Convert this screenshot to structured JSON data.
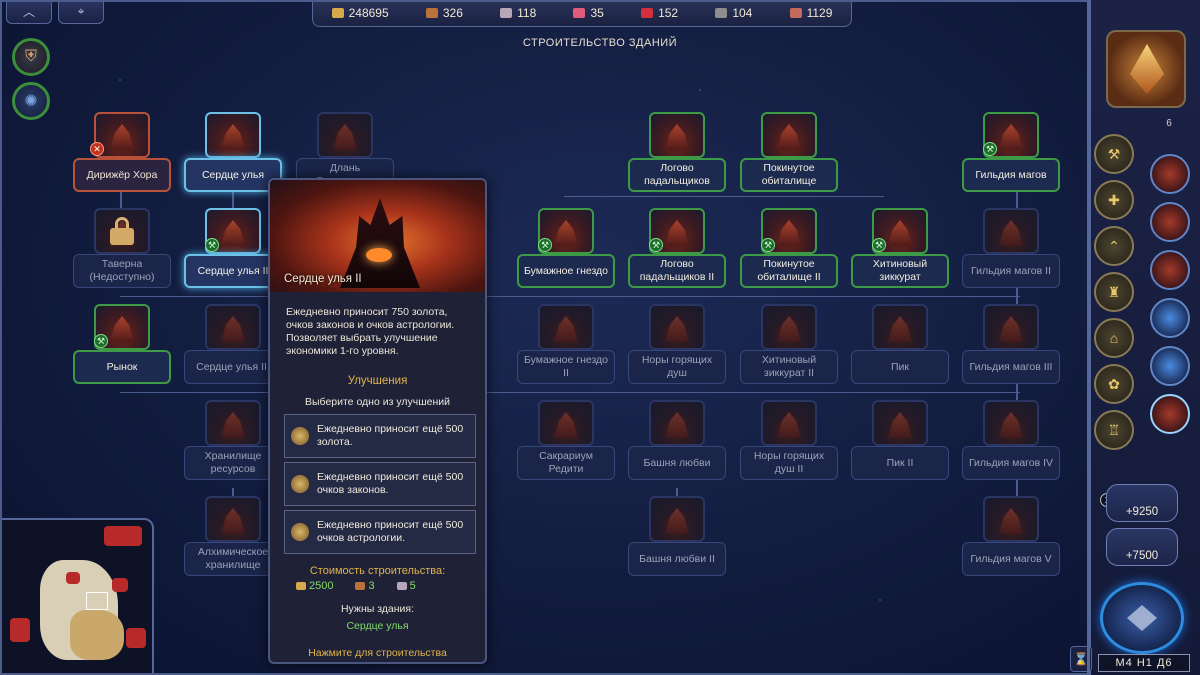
{
  "window_title": "СТРОИТЕЛЬСТВО ЗДАНИЙ",
  "resources": [
    {
      "name": "gold",
      "value": "248695",
      "color": "#d8a94a"
    },
    {
      "name": "wood",
      "value": "326",
      "color": "#b9733a"
    },
    {
      "name": "ore",
      "value": "118",
      "color": "#b7a6b8"
    },
    {
      "name": "crystals",
      "value": "35",
      "color": "#e25a7a"
    },
    {
      "name": "gems",
      "value": "152",
      "color": "#d2303a"
    },
    {
      "name": "mercury",
      "value": "104",
      "color": "#8e8e8e"
    },
    {
      "name": "sulfur",
      "value": "1129",
      "color": "#c46a5a"
    }
  ],
  "buildings": [
    {
      "label": "Дирижёр Хора",
      "state": "red"
    },
    {
      "label": "Сердце улья",
      "state": "built"
    },
    {
      "label": "Длань Вельзевула",
      "state": "dim"
    },
    {
      "label": "Логово падальщиков",
      "state": "built"
    },
    {
      "label": "Покинутое обиталище",
      "state": "built"
    },
    {
      "label": "Гильдия магов",
      "state": "built"
    },
    {
      "label": "Таверна (Недоступно)",
      "state": "locked"
    },
    {
      "label": "Сердце улья II",
      "state": "sel"
    },
    {
      "label": "Бумажное гнездо",
      "state": "built"
    },
    {
      "label": "Логово падальщиков II",
      "state": "built"
    },
    {
      "label": "Покинутое обиталище II",
      "state": "built"
    },
    {
      "label": "Хитиновый зиккурат",
      "state": "built"
    },
    {
      "label": "Гильдия магов II",
      "state": "dim"
    },
    {
      "label": "Рынок",
      "state": "built"
    },
    {
      "label": "Сердце улья III",
      "state": "dim"
    },
    {
      "label": "Бумажное гнездо II",
      "state": "dim"
    },
    {
      "label": "Норы горящих душ",
      "state": "dim"
    },
    {
      "label": "Хитиновый зиккурат II",
      "state": "dim"
    },
    {
      "label": "Пик",
      "state": "dim"
    },
    {
      "label": "Гильдия магов III",
      "state": "dim"
    },
    {
      "label": "Хранилище ресурсов",
      "state": "dim"
    },
    {
      "label": "Сакрариум Редити",
      "state": "dim"
    },
    {
      "label": "Башня любви",
      "state": "dim"
    },
    {
      "label": "Норы горящих душ II",
      "state": "dim"
    },
    {
      "label": "Пик II",
      "state": "dim"
    },
    {
      "label": "Гильдия магов IV",
      "state": "dim"
    },
    {
      "label": "Алхимическое хранилище",
      "state": "dim"
    },
    {
      "label": "Башня любви II",
      "state": "dim"
    },
    {
      "label": "Гильдия магов V",
      "state": "dim"
    }
  ],
  "tooltip": {
    "title": "Сердце улья II",
    "description": "Ежедневно приносит 750 золота, очков законов и очков астрологии. Позволяет выбрать улучшение экономики 1-го уровня.",
    "upgrades_title": "Улучшения",
    "upgrades_subtitle": "Выберите одно из улучшений",
    "options": [
      {
        "text": "Ежедневно приносит ещё 500 золота.",
        "icon": "gold-icon"
      },
      {
        "text": "Ежедневно приносит ещё 500 очков законов.",
        "icon": "scales-icon"
      },
      {
        "text": "Ежедневно приносит ещё 500 очков астрологии.",
        "icon": "astrology-icon"
      }
    ],
    "cost_title": "Стоимость строительства:",
    "costs": [
      {
        "value": "2500",
        "color": "#d8a94a"
      },
      {
        "value": "3",
        "color": "#b9733a"
      },
      {
        "value": "5",
        "color": "#b7a6b8"
      }
    ],
    "requires_title": "Нужны здания:",
    "requires_value": "Сердце улья",
    "action": "Нажмите для строительства"
  },
  "right_panel": {
    "turn_counter": "6",
    "income_1": "+9250",
    "income_2": "+7500",
    "notification": "1",
    "date": "М4 Н1 Д6",
    "hourglass_icon": "hourglass-icon"
  },
  "accent_green": "#3d9a46",
  "accent_selected": "#6ec1e6"
}
